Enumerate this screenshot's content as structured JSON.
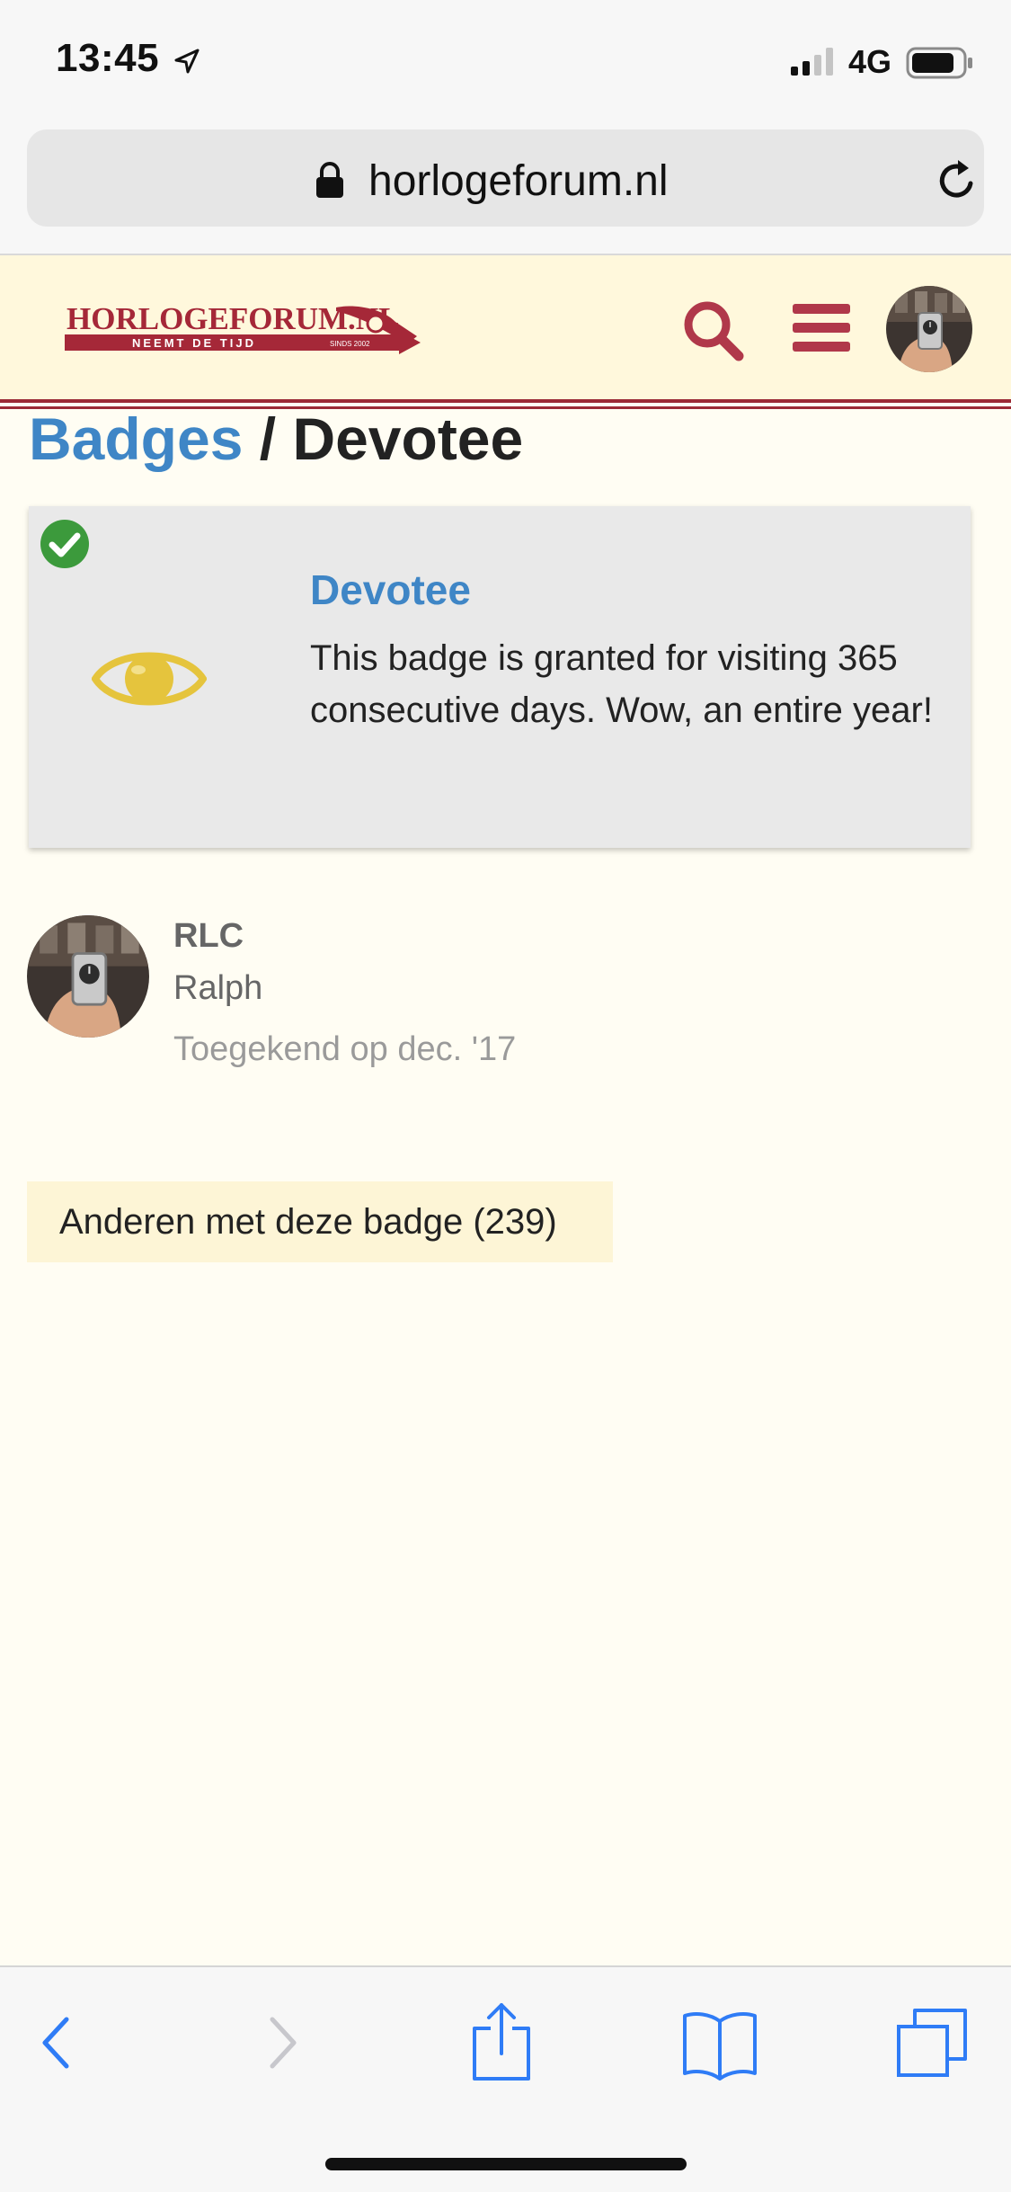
{
  "status_bar": {
    "time": "13:45",
    "network": "4G"
  },
  "browser": {
    "url": "horlogeforum.nl"
  },
  "header": {
    "logo_text": "HORLOGEFORUM.NL",
    "logo_tagline": "NEEMT DE TIJD",
    "logo_since": "SINDS 2002"
  },
  "breadcrumb": {
    "parent": "Badges",
    "separator": " / ",
    "current": "Devotee"
  },
  "badge": {
    "name": "Devotee",
    "description": "This badge is granted for visiting 365 consecutive days. Wow, an entire year!",
    "icon": "eye-icon",
    "granted": true
  },
  "user": {
    "handle": "RLC",
    "full_name": "Ralph",
    "granted_on": "Toegekend op dec. '17"
  },
  "others_button": {
    "label": "Anderen met deze badge (239)"
  },
  "colors": {
    "link_blue": "#3f86c6",
    "brand_red": "#b0384a",
    "badge_gold": "#e5c43d",
    "check_green": "#3c9a3c",
    "header_bg": "#fff8dc"
  },
  "icons": {
    "search": "search-icon",
    "menu": "hamburger-menu-icon",
    "lock": "lock-icon",
    "reload": "reload-icon",
    "back": "back-chevron-icon",
    "forward": "forward-chevron-icon",
    "share": "share-icon",
    "bookmarks": "bookmarks-icon",
    "tabs": "tabs-icon"
  }
}
